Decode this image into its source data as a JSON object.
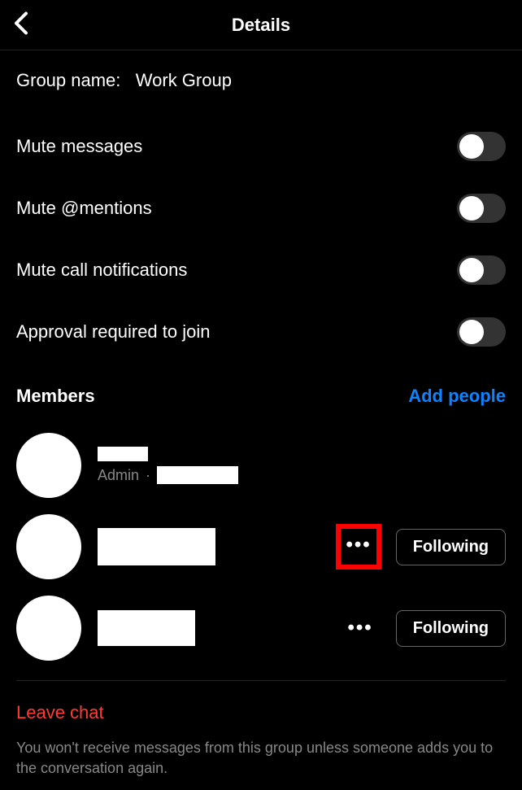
{
  "header": {
    "title": "Details"
  },
  "group": {
    "label": "Group name:",
    "name": "Work Group"
  },
  "settings": [
    {
      "label": "Mute messages"
    },
    {
      "label": "Mute @mentions"
    },
    {
      "label": "Mute call notifications"
    },
    {
      "label": "Approval required to join"
    }
  ],
  "members": {
    "title": "Members",
    "add_label": "Add people",
    "items": [
      {
        "admin_label": "Admin",
        "separator": "·",
        "following_label": ""
      },
      {
        "following_label": "Following"
      },
      {
        "following_label": "Following"
      }
    ]
  },
  "leave": {
    "label": "Leave chat",
    "description": "You won't receive messages from this group unless someone adds you to the conversation again."
  }
}
